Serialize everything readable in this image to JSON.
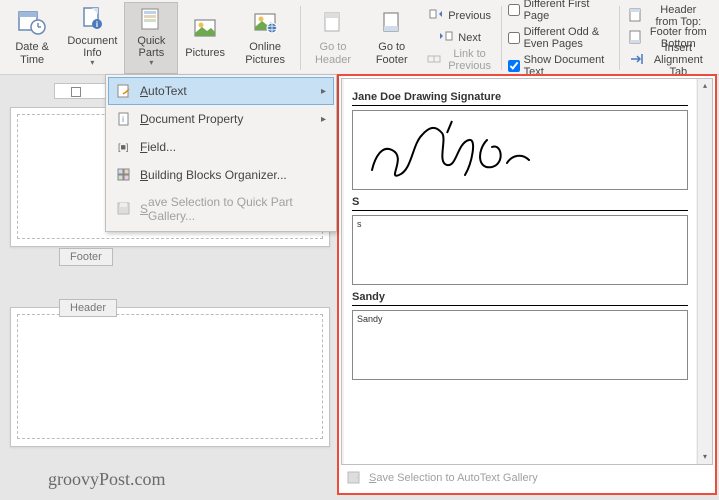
{
  "ribbon": {
    "date_time": "Date & Time",
    "doc_info": "Document Info",
    "quick_parts": "Quick Parts",
    "pictures": "Pictures",
    "online_pictures": "Online Pictures",
    "goto_header": "Go to Header",
    "goto_footer": "Go to Footer",
    "previous": "Previous",
    "next": "Next",
    "link_previous": "Link to Previous",
    "diff_first": "Different First Page",
    "diff_odd_even": "Different Odd & Even Pages",
    "show_doc_text": "Show Document Text",
    "header_from_top": "Header from Top:",
    "footer_from_bottom": "Footer from Bottom",
    "insert_align_tab": "Insert Alignment Tab"
  },
  "dropdown": {
    "autotext": "AutoText",
    "doc_property": "Document Property",
    "field": "Field...",
    "building_blocks": "Building Blocks Organizer...",
    "save_quickpart": "Save Selection to Quick Part Gallery..."
  },
  "flyout": {
    "entries": [
      {
        "title": "Jane Doe Drawing Signature",
        "type": "signature"
      },
      {
        "title": "S",
        "content": "s"
      },
      {
        "title": "Sandy",
        "content": "Sandy"
      }
    ],
    "footer": "Save Selection to AutoText Gallery"
  },
  "page_labels": {
    "footer": "Footer",
    "header": "Header"
  },
  "watermark": "groovyPost.com"
}
